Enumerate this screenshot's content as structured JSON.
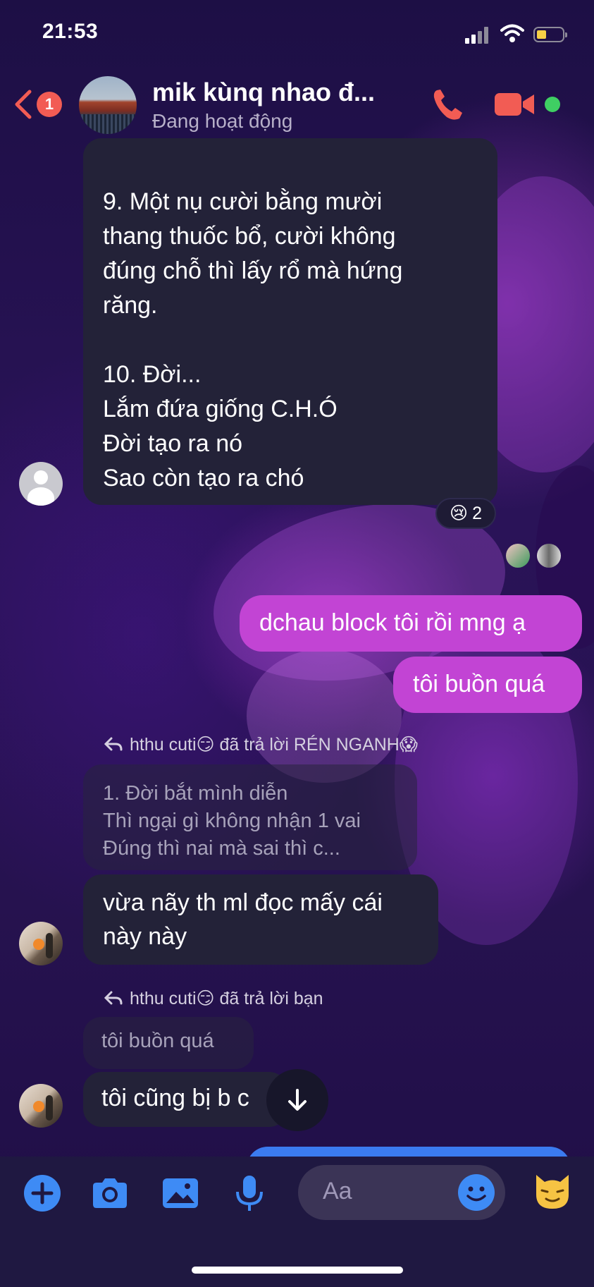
{
  "status_bar": {
    "time": "21:53"
  },
  "header": {
    "back_badge": "1",
    "title": "mik kùnq nhao đ...",
    "subtitle": "Đang hoạt động"
  },
  "messages": {
    "m1": {
      "lines": [
        "9. Một nụ cười bằng mười",
        "thang thuốc bổ, cười không",
        "đúng chỗ thì lấy rổ mà hứng",
        "răng.",
        "",
        "10. Đời...",
        "Lắm đứa giống C.H.Ó",
        "Đời tạo ra nó",
        "Sao còn tạo ra chó"
      ],
      "reaction_emoji": "😢",
      "reaction_count": "2"
    },
    "out1": "dchau block tôi rồi mng ạ",
    "out2": "tôi buồn quá",
    "reply1": {
      "line": "hthu cuti😏 đã trả lời RÉN NGANH😱",
      "quote_lines": [
        "1. Đời bắt mình diễn",
        "Thì ngại gì không nhận 1 vai",
        "Đúng thì nai mà sai thì c..."
      ],
      "text_lines": [
        "vừa nãy th ml đọc mấy cái",
        "này này"
      ]
    },
    "reply2": {
      "line": "hthu cuti😏 đã trả lời bạn",
      "quote": "tôi buồn quá",
      "text": "tôi cũng bị b c"
    }
  },
  "composer": {
    "placeholder": "Aa"
  },
  "colors": {
    "outgoing": "#c244d4",
    "incoming": "#232238",
    "accent": "#3e8bf5",
    "header_icons": "#f25c54"
  }
}
